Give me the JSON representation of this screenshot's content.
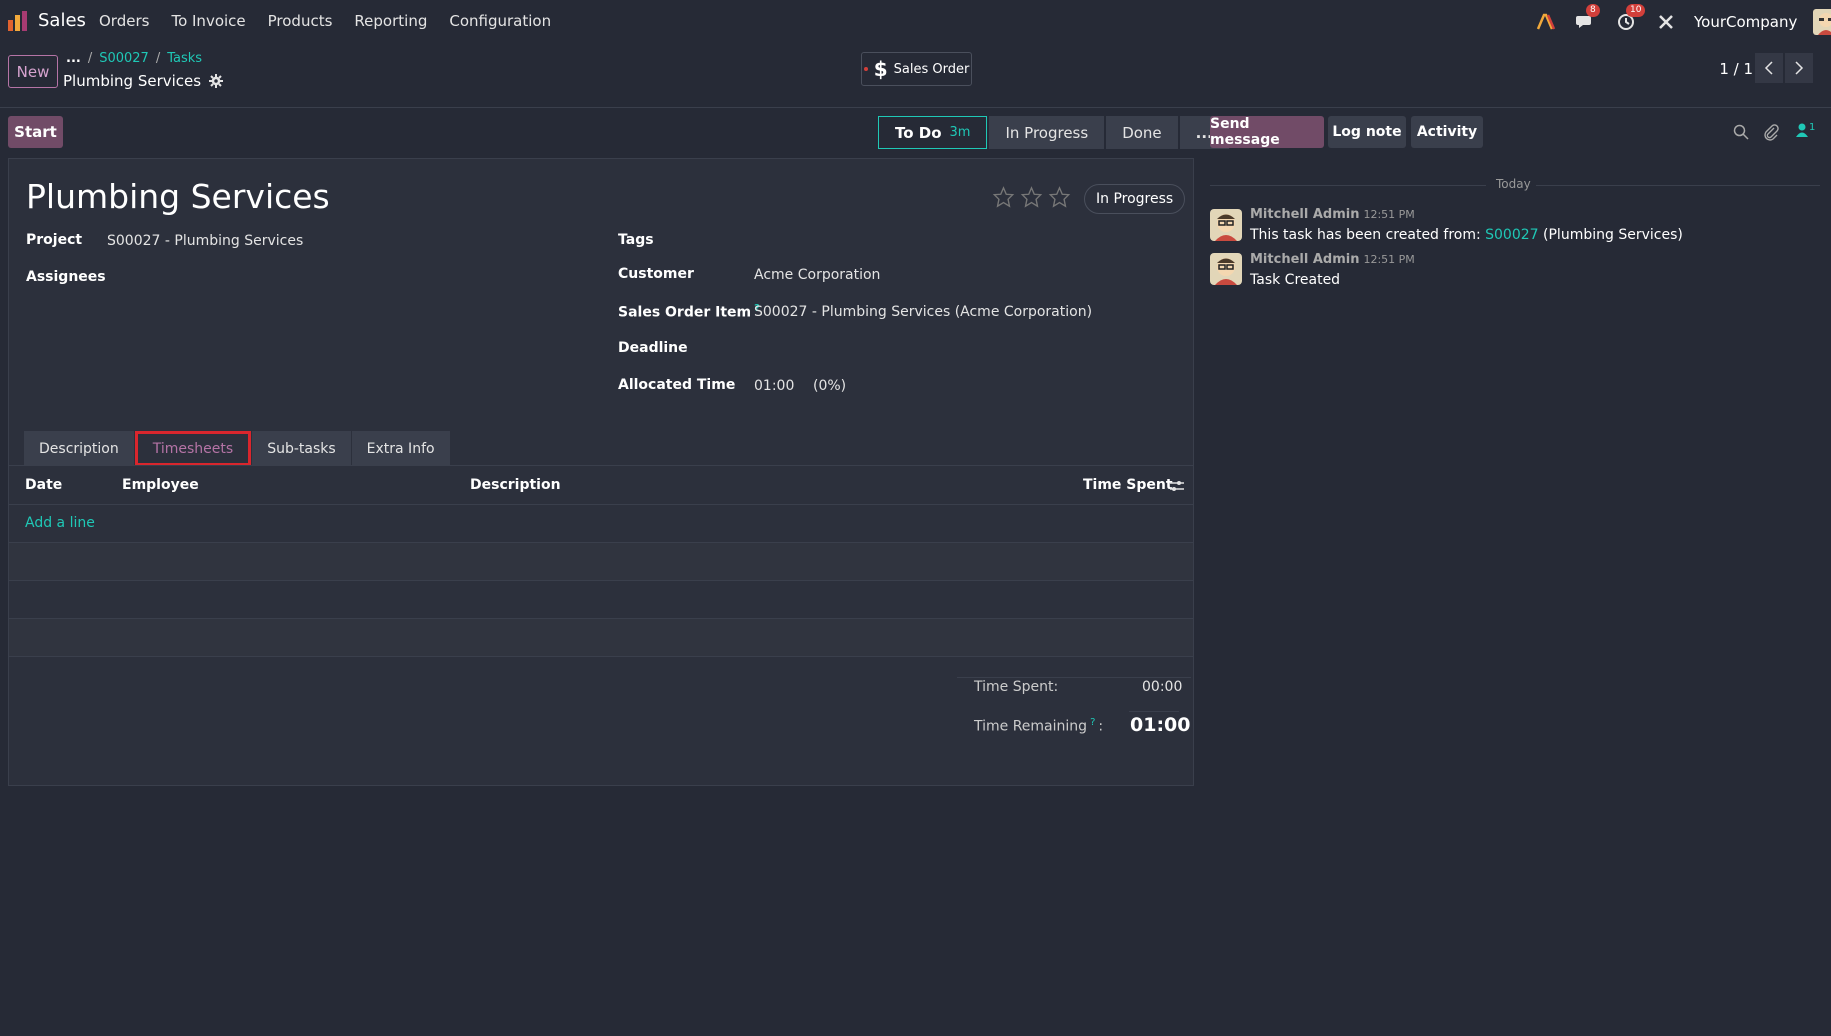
{
  "nav": {
    "app_name": "Sales",
    "menu": [
      "Orders",
      "To Invoice",
      "Products",
      "Reporting",
      "Configuration"
    ],
    "messages_badge": "8",
    "activity_badge": "10",
    "company": "YourCompany"
  },
  "control": {
    "new_label": "New",
    "breadcrumb_ellipsis": "...",
    "breadcrumb_order": "S00027",
    "breadcrumb_tasks": "Tasks",
    "record_title": "Plumbing Services",
    "smart_button": "Sales Order",
    "pager": "1 / 1"
  },
  "status": {
    "start_label": "Start",
    "stages": [
      {
        "label": "To Do",
        "time": "3m"
      },
      {
        "label": "In Progress"
      },
      {
        "label": "Done"
      },
      {
        "label": "..."
      }
    ]
  },
  "form": {
    "title": "Plumbing Services",
    "state_pill": "In Progress",
    "project_label": "Project",
    "project_value": "S00027 - Plumbing Services",
    "assignees_label": "Assignees",
    "tags_label": "Tags",
    "customer_label": "Customer",
    "customer_value": "Acme Corporation",
    "soi_label": "Sales Order Item",
    "soi_value": "S00027 - Plumbing Services (Acme Corporation)",
    "deadline_label": "Deadline",
    "alloc_label": "Allocated Time",
    "alloc_value": "01:00",
    "alloc_pct": "(0%)",
    "help_mark": "?"
  },
  "tabs": [
    "Description",
    "Timesheets",
    "Sub-tasks",
    "Extra Info"
  ],
  "timesheet": {
    "columns": [
      "Date",
      "Employee",
      "Description",
      "Time Spent"
    ],
    "add_line": "Add a line",
    "time_spent_label": "Time Spent:",
    "time_spent_value": "00:00",
    "time_remaining_label": "Time Remaining",
    "time_remaining_colon": ":",
    "time_remaining_value": "01:00"
  },
  "chatter": {
    "send_message": "Send message",
    "log_note": "Log note",
    "activity": "Activity",
    "followers_count": "1",
    "today": "Today",
    "messages": [
      {
        "author": "Mitchell Admin",
        "time": "12:51 PM",
        "text_before": "This task has been created from:",
        "link": "S00027",
        "text_after": "(Plumbing Services)"
      },
      {
        "author": "Mitchell Admin",
        "time": "12:51 PM",
        "text_before": "Task Created"
      }
    ]
  },
  "colors": {
    "accent": "#1fc8b6",
    "primary": "#714b67",
    "bg": "#262a36"
  }
}
